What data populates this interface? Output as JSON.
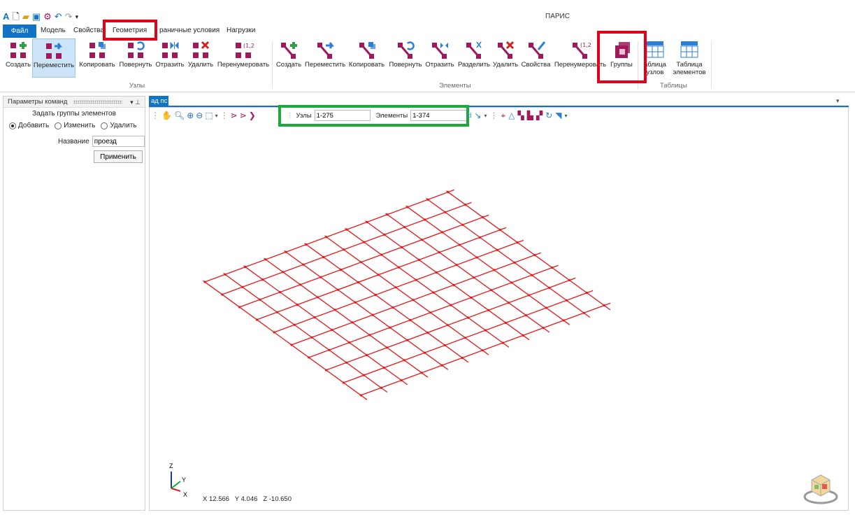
{
  "app": {
    "title": "ПАРИС",
    "quick_access": [
      "app-logo-icon",
      "new-file-icon",
      "open-folder-icon",
      "save-icon",
      "settings-icon",
      "undo-icon",
      "redo-icon",
      "customize-qat-icon"
    ]
  },
  "tabs": {
    "file": "Файл",
    "model": "Модель",
    "properties": "Свойства",
    "geometry": "Геометрия",
    "boundary": "раничные условия",
    "loads": "Нагрузки"
  },
  "ribbon": {
    "nodes_group": {
      "label": "Узлы",
      "buttons": [
        "Создать",
        "Переместить",
        "Копировать",
        "Повернуть",
        "Отразить",
        "Удалить",
        "Перенумеровать"
      ]
    },
    "elements_group": {
      "label": "Элементы",
      "buttons": [
        "Создать",
        "Переместить",
        "Копировать",
        "Повернуть",
        "Отразить",
        "Разделить",
        "Удалить",
        "Свойства",
        "Перенумеровать",
        "Группы"
      ]
    },
    "tables_group": {
      "label": "Таблицы",
      "node_table": [
        "аблица",
        "узлов"
      ],
      "element_table": [
        "Таблица",
        "элементов"
      ]
    }
  },
  "left_panel": {
    "header": "Параметры команд",
    "header_controls": "▾ ⊥",
    "title": "Задать группы элементов",
    "radios": {
      "add": "Добавить",
      "edit": "Изменить",
      "delete": "Удалить",
      "selected": "add"
    },
    "name_label": "Название",
    "name_value": "проезд",
    "apply": "Применить"
  },
  "viewport": {
    "doc_tab": "ад пс",
    "nodes_label": "Узлы",
    "nodes_value": "1-275",
    "elements_label": "Элементы",
    "elements_value": "1-374",
    "coords": {
      "x_label": "X",
      "x": "12.566",
      "y_label": "Y",
      "y": "4.046",
      "z_label": "Z",
      "z": "-10.650"
    },
    "axes": {
      "z": "Z",
      "y": "Y",
      "x": "X"
    },
    "grid": {
      "lines_a": 13,
      "lines_b": 10,
      "color": "#e8171b"
    }
  },
  "colors": {
    "accent": "#1173c6",
    "icon_magenta": "#a0195a",
    "icon_green": "#2ea043",
    "icon_blue": "#2b7fd6",
    "icon_red": "#d42020",
    "highlight_red": "#e3001b",
    "highlight_green": "#1bab3a"
  }
}
